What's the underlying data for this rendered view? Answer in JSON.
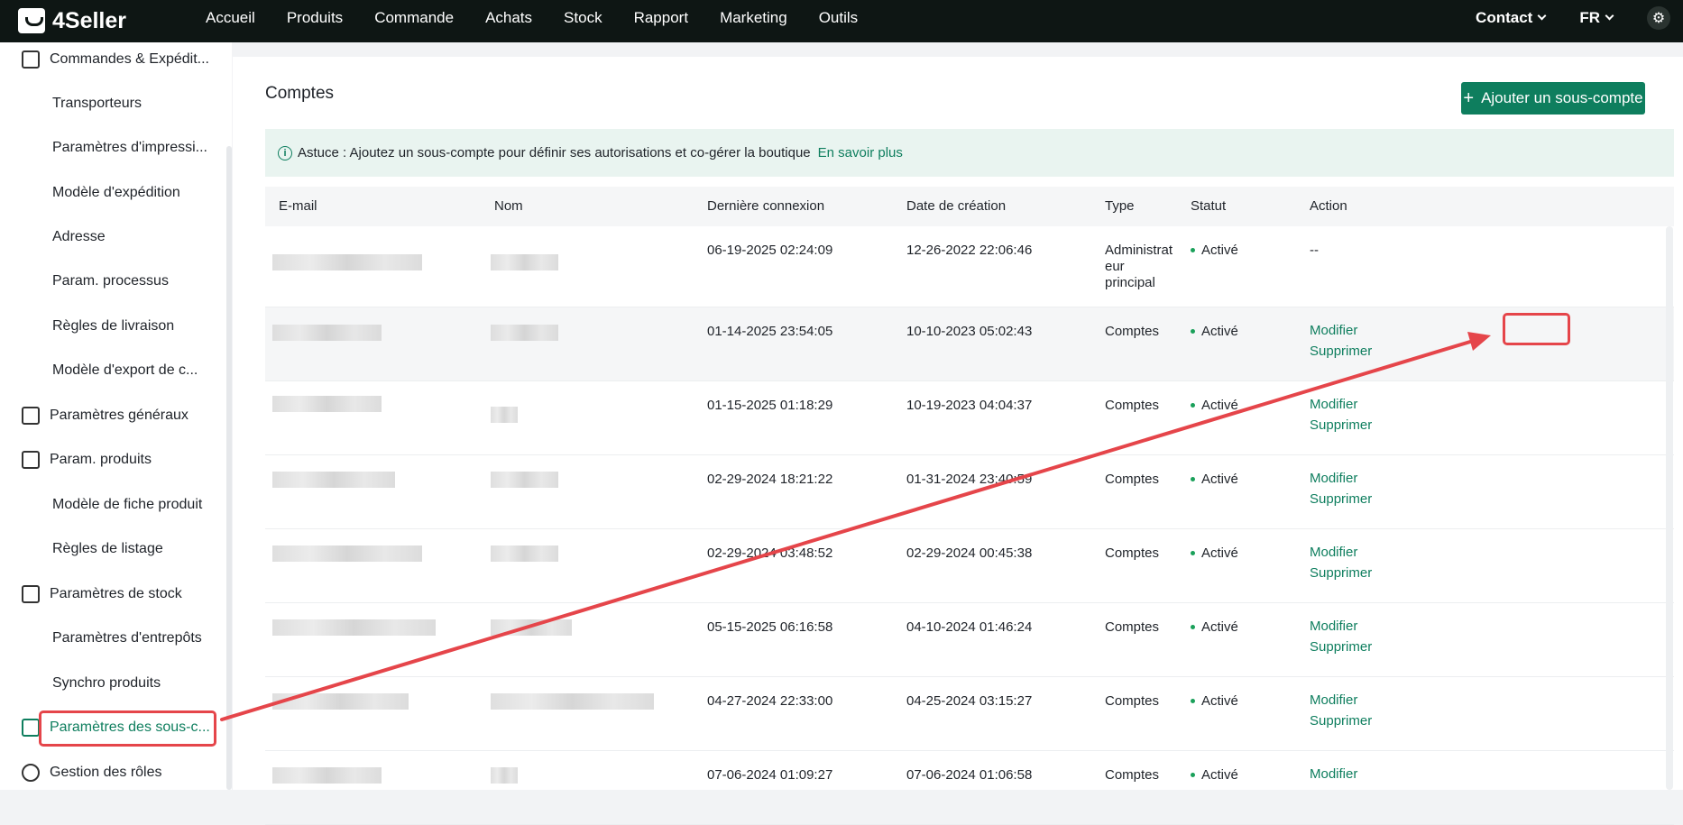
{
  "app": {
    "logo_text": "4Seller"
  },
  "nav": [
    "Accueil",
    "Produits",
    "Commande",
    "Achats",
    "Stock",
    "Rapport",
    "Marketing",
    "Outils"
  ],
  "header": {
    "contact_label": "Contact",
    "lang_label": "FR"
  },
  "sidebar": {
    "items": [
      {
        "label": "Commandes & Expédit...",
        "kind": "group",
        "icon": "order-icon"
      },
      {
        "label": "Transporteurs",
        "kind": "sub"
      },
      {
        "label": "Paramètres d'impressi...",
        "kind": "sub"
      },
      {
        "label": "Modèle d'expédition",
        "kind": "sub"
      },
      {
        "label": "Adresse",
        "kind": "sub"
      },
      {
        "label": "Param. processus",
        "kind": "sub"
      },
      {
        "label": "Règles de livraison",
        "kind": "sub"
      },
      {
        "label": "Modèle d'export de c...",
        "kind": "sub"
      },
      {
        "label": "Paramètres généraux",
        "kind": "group",
        "icon": "printer-icon"
      },
      {
        "label": "Param. produits",
        "kind": "group",
        "icon": "upload-box-icon"
      },
      {
        "label": "Modèle de fiche produit",
        "kind": "sub"
      },
      {
        "label": "Règles de listage",
        "kind": "sub"
      },
      {
        "label": "Paramètres de stock",
        "kind": "group",
        "icon": "warehouse-icon"
      },
      {
        "label": "Paramètres d'entrepôts",
        "kind": "sub"
      },
      {
        "label": "Synchro produits",
        "kind": "sub"
      },
      {
        "label": "Paramètres des sous-c...",
        "kind": "group",
        "icon": "subaccount-icon",
        "active": true
      },
      {
        "label": "Gestion des rôles",
        "kind": "group",
        "icon": "user-icon"
      }
    ]
  },
  "main": {
    "title": "Comptes",
    "add_button": "Ajouter un sous-compte",
    "tip": {
      "text": "Astuce : Ajoutez un sous-compte pour définir ses autorisations et co-gérer la boutique",
      "link": "En savoir plus"
    },
    "columns": [
      "E-mail",
      "Nom",
      "Dernière connexion",
      "Date de création",
      "Type",
      "Statut",
      "Action"
    ],
    "rows": [
      {
        "last_login": "06-19-2025 02:24:09",
        "created": "12-26-2022 22:06:46",
        "type": "Administrat eur principal",
        "status": "Activé",
        "actions": [
          "--"
        ]
      },
      {
        "last_login": "01-14-2025 23:54:05",
        "created": "10-10-2023 05:02:43",
        "type": "Comptes",
        "status": "Activé",
        "actions": [
          "Modifier",
          "Supprimer"
        ]
      },
      {
        "last_login": "01-15-2025 01:18:29",
        "created": "10-19-2023 04:04:37",
        "type": "Comptes",
        "status": "Activé",
        "actions": [
          "Modifier",
          "Supprimer"
        ]
      },
      {
        "last_login": "02-29-2024 18:21:22",
        "created": "01-31-2024 23:40:59",
        "type": "Comptes",
        "status": "Activé",
        "actions": [
          "Modifier",
          "Supprimer"
        ]
      },
      {
        "last_login": "02-29-2024 03:48:52",
        "created": "02-29-2024 00:45:38",
        "type": "Comptes",
        "status": "Activé",
        "actions": [
          "Modifier",
          "Supprimer"
        ]
      },
      {
        "last_login": "05-15-2025 06:16:58",
        "created": "04-10-2024 01:46:24",
        "type": "Comptes",
        "status": "Activé",
        "actions": [
          "Modifier",
          "Supprimer"
        ]
      },
      {
        "last_login": "04-27-2024 22:33:00",
        "created": "04-25-2024 03:15:27",
        "type": "Comptes",
        "status": "Activé",
        "actions": [
          "Modifier",
          "Supprimer"
        ]
      },
      {
        "last_login": "07-06-2024 01:09:27",
        "created": "07-06-2024 01:06:58",
        "type": "Comptes",
        "status": "Activé",
        "actions": [
          "Modifier"
        ]
      }
    ]
  },
  "colors": {
    "brand": "#0e7e5e",
    "topbar": "#0e1614",
    "highlight": "#e5454a",
    "status_dot": "#1aa05a"
  }
}
